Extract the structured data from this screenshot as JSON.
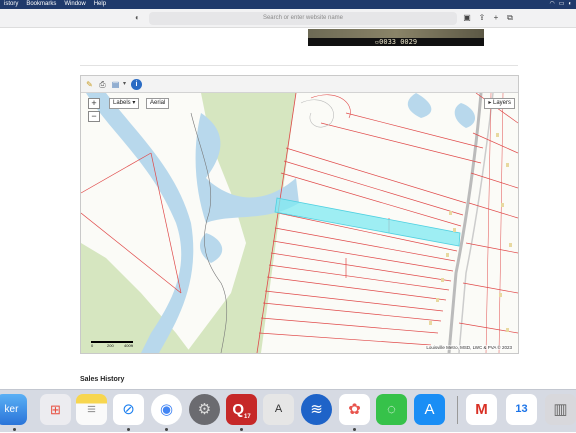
{
  "menubar": {
    "items": [
      "istory",
      "Bookmarks",
      "Window",
      "Help"
    ]
  },
  "browser": {
    "url_placeholder": "Search or enter website name"
  },
  "camera": {
    "overlay_text": "▫0033  0029"
  },
  "map": {
    "labels_button": "Labels ▾",
    "aerial_button": "Aerial",
    "layers_button": "▸ Layers",
    "zoom_in": "+",
    "zoom_out": "−",
    "attribution": "Louisville Metro, MSD, LWC & PVA © 2023",
    "scale": {
      "l0": "0",
      "l1": "200",
      "l2": "400ft"
    },
    "colors": {
      "parcel_line": "#e04a4a",
      "water": "#b8d8ec",
      "green": "#d6e6c0",
      "highlight": "#7fe9f2"
    }
  },
  "content": {
    "section_heading": "Sales History"
  },
  "dock": {
    "finder_label": "ker",
    "calendar_day": "13",
    "q_label": "Q",
    "q_sub": "17"
  }
}
